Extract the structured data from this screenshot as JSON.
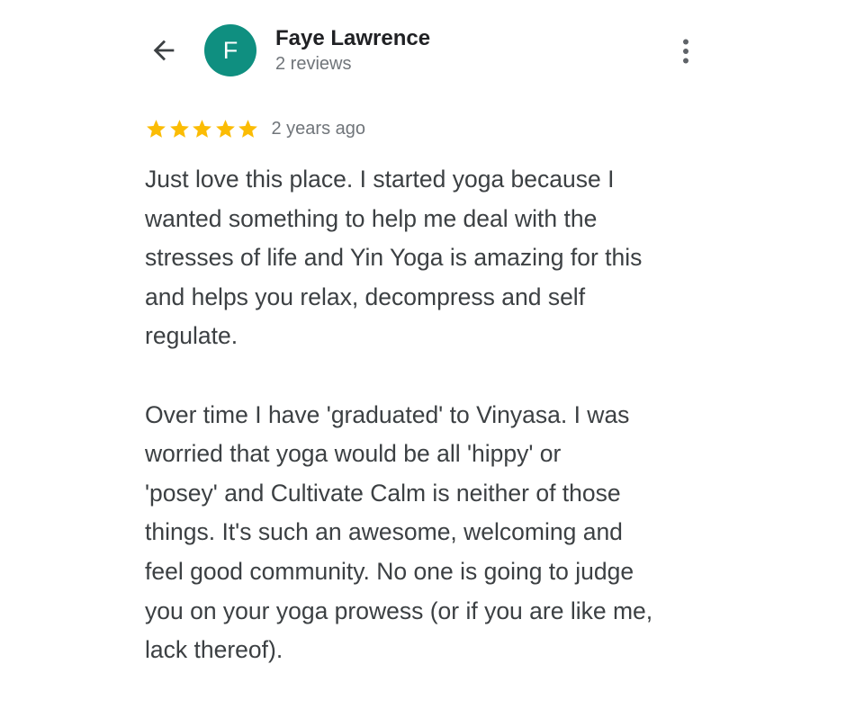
{
  "header": {
    "back_icon": "arrow-back-icon",
    "avatar": {
      "initial": "F",
      "color": "#0f8f80"
    },
    "reviewer_name": "Faye Lawrence",
    "review_count": "2 reviews",
    "more_icon": "more-vertical-icon"
  },
  "review": {
    "rating": 5,
    "rating_max": 5,
    "star_color": "#fbbc04",
    "timestamp": "2 years ago",
    "paragraphs": [
      "Just love this place. I started yoga because I\nwanted something to help me deal with the\nstresses of life and Yin Yoga is amazing for this\nand helps you relax, decompress and self\nregulate.",
      "Over time I have 'graduated' to Vinyasa. I was\nworried that yoga would be all 'hippy' or\n'posey' and Cultivate Calm is neither of those\nthings. It's such an awesome, welcoming and\nfeel good community. No one is going to judge\nyou on your yoga prowess (or if you are like me,\nlack thereof)."
    ]
  }
}
